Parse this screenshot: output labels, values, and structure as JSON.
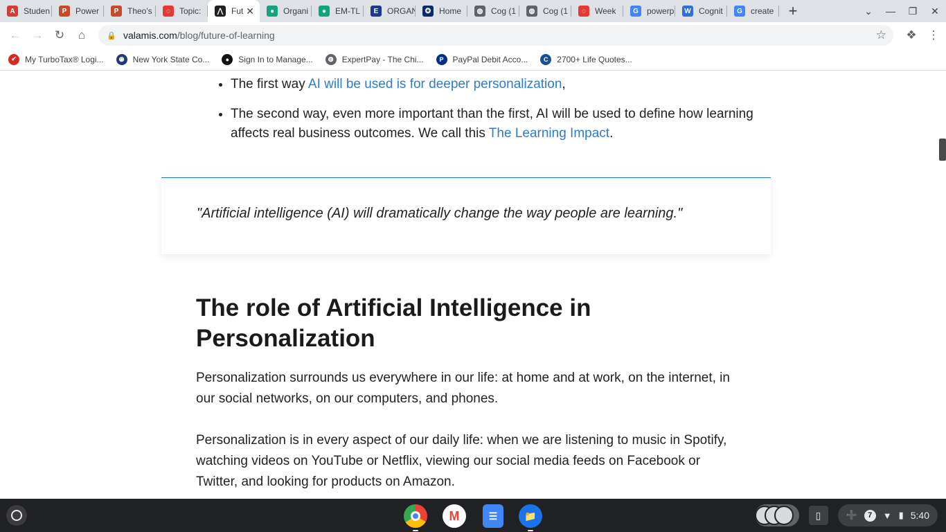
{
  "tabs": [
    {
      "label": "Studen",
      "icon": "letter-a-icon",
      "color": "#d33b3b",
      "glyph": "A"
    },
    {
      "label": "Power",
      "icon": "powerpoint-icon",
      "color": "#c6492b",
      "glyph": "P"
    },
    {
      "label": "Theo's",
      "icon": "powerpoint-icon",
      "color": "#c6492b",
      "glyph": "P"
    },
    {
      "label": "Topic:",
      "icon": "spinner-icon",
      "color": "#e53935",
      "glyph": "◌"
    },
    {
      "label": "Fut",
      "icon": "valamis-icon",
      "color": "#202124",
      "glyph": "⋀",
      "active": true
    },
    {
      "label": "Organi",
      "icon": "kiwi-icon",
      "color": "#12a37f",
      "glyph": "●"
    },
    {
      "label": "EM-TL",
      "icon": "kiwi-icon",
      "color": "#12a37f",
      "glyph": "●"
    },
    {
      "label": "ORGAN",
      "icon": "letter-e-icon",
      "color": "#1e3a8a",
      "glyph": "E"
    },
    {
      "label": "Home",
      "icon": "hexagon-icon",
      "color": "#0b2a6b",
      "glyph": "✪"
    },
    {
      "label": "Cog (1",
      "icon": "globe-icon",
      "color": "#5f6368",
      "glyph": "◍"
    },
    {
      "label": "Cog (1",
      "icon": "globe-icon",
      "color": "#5f6368",
      "glyph": "◍"
    },
    {
      "label": "Week",
      "icon": "spinner-icon",
      "color": "#e53935",
      "glyph": "◌"
    },
    {
      "label": "powerp",
      "icon": "google-icon",
      "color": "#4285f4",
      "glyph": "G"
    },
    {
      "label": "Cognit",
      "icon": "letter-w-icon",
      "color": "#2f6fd6",
      "glyph": "W"
    },
    {
      "label": "create",
      "icon": "google-icon",
      "color": "#4285f4",
      "glyph": "G"
    }
  ],
  "url": {
    "host": "valamis.com",
    "path": "/blog/future-of-learning"
  },
  "bookmarks": [
    {
      "label": "My TurboTax® Logi...",
      "icon": "turbotax-icon",
      "color": "#d52b1e",
      "glyph": "✔"
    },
    {
      "label": "New York State Co...",
      "icon": "nys-seal-icon",
      "color": "#1f3b73",
      "glyph": "◉"
    },
    {
      "label": "Sign In to Manage...",
      "icon": "circle-logo-icon",
      "color": "#111111",
      "glyph": "●"
    },
    {
      "label": "ExpertPay - The Chi...",
      "icon": "globe-icon",
      "color": "#5f6368",
      "glyph": "◍"
    },
    {
      "label": "PayPal Debit Acco...",
      "icon": "paypal-icon",
      "color": "#003087",
      "glyph": "P"
    },
    {
      "label": "2700+ Life Quotes...",
      "icon": "letter-c-icon",
      "color": "#1b4f8f",
      "glyph": "C"
    }
  ],
  "article": {
    "bullet1": {
      "text": "The first way ",
      "link": "AI will be used is for deeper personalization",
      "tail": ","
    },
    "bullet2": {
      "text": "The second way, even more important than the first, AI will be used to define how learning affects real business outcomes. We call this ",
      "link": "The Learning Impact",
      "tail": "."
    },
    "quote": "\"Artificial intelligence (AI) will dramatically change the way people are learning.\"",
    "heading": "The role of Artificial Intelligence in Personalization",
    "para1": "Personalization surrounds us everywhere in our life: at home and at work, on the internet, in our social networks, on our computers, and phones.",
    "para2": "Personalization is in every aspect of our daily life: when we are listening to music in Spotify, watching videos on YouTube or Netflix, viewing our social media feeds on Facebook or Twitter, and looking for products on Amazon."
  },
  "shelf": {
    "apps": [
      {
        "name": "chrome-icon",
        "color": "#4285f4"
      },
      {
        "name": "gmail-icon",
        "color": "#ffffff"
      },
      {
        "name": "docs-icon",
        "color": "#4285f4"
      },
      {
        "name": "files-icon",
        "color": "#1a73e8"
      }
    ],
    "notification_count": "7",
    "time": "5:40"
  }
}
